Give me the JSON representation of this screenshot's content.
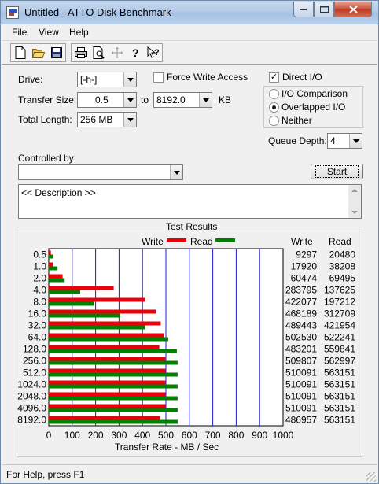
{
  "window": {
    "title": "Untitled - ATTO Disk Benchmark"
  },
  "menu": [
    "File",
    "View",
    "Help"
  ],
  "toolbar": {
    "icons": [
      "new-document-icon",
      "open-folder-icon",
      "save-icon",
      "print-icon",
      "print-preview-icon",
      "move-icon",
      "help-icon",
      "context-help-icon"
    ]
  },
  "form": {
    "drive_label": "Drive:",
    "drive_value": "[-h-]",
    "force_write_label": "Force Write Access",
    "force_write_checked": false,
    "direct_io_label": "Direct I/O",
    "direct_io_checked": true,
    "transfer_size_label": "Transfer Size:",
    "transfer_from": "0.5",
    "to_label": "to",
    "transfer_to": "8192.0",
    "kb_label": "KB",
    "total_length_label": "Total Length:",
    "total_length": "256 MB",
    "io_options": [
      "I/O Comparison",
      "Overlapped I/O",
      "Neither"
    ],
    "io_selected": "Overlapped I/O",
    "queue_depth_label": "Queue Depth:",
    "queue_depth": "4",
    "controlled_by_label": "Controlled by:",
    "controlled_by_value": "",
    "start_label": "Start",
    "description": "<< Description >>"
  },
  "results": {
    "title": "Test Results",
    "legend_write": "Write",
    "legend_read": "Read",
    "col_write": "Write",
    "col_read": "Read"
  },
  "chart_data": {
    "type": "bar",
    "orientation": "horizontal",
    "title": "Test Results",
    "xlabel": "Transfer Rate - MB / Sec",
    "ylabel": "",
    "xlim": [
      0,
      1000
    ],
    "xticks": [
      0,
      100,
      200,
      300,
      400,
      500,
      600,
      700,
      800,
      900,
      1000
    ],
    "categories": [
      "0.5",
      "1.0",
      "2.0",
      "4.0",
      "8.0",
      "16.0",
      "32.0",
      "64.0",
      "128.0",
      "256.0",
      "512.0",
      "1024.0",
      "2048.0",
      "4096.0",
      "8192.0"
    ],
    "series": [
      {
        "name": "Write",
        "color": "#e8000b",
        "values_kb": [
          9297,
          17920,
          60474,
          283795,
          422077,
          468189,
          489443,
          502530,
          483201,
          509807,
          510091,
          510091,
          510091,
          510091,
          486957
        ]
      },
      {
        "name": "Read",
        "color": "#008000",
        "values_kb": [
          20480,
          38208,
          69495,
          137625,
          197212,
          312709,
          421954,
          522241,
          559841,
          562997,
          563151,
          563151,
          563151,
          563151,
          563151
        ]
      }
    ],
    "grid": true,
    "legend": "top"
  },
  "status": {
    "text": "For Help, press F1"
  }
}
